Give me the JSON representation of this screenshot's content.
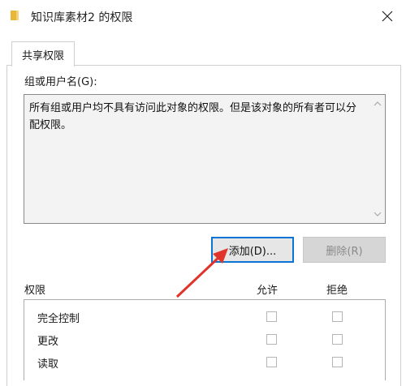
{
  "window": {
    "title": "知识库素材2 的权限",
    "folder_icon": "folder-icon",
    "close_icon": "close-icon",
    "accent_color": "#0a74d4",
    "arrow_color": "#e0342b"
  },
  "tabs": [
    {
      "label": "共享权限",
      "selected": true
    }
  ],
  "users": {
    "label": "组或用户名(G):",
    "message": "所有组或用户均不具有访问此对象的权限。但是该对象的所有者可以分配权限。"
  },
  "buttons": {
    "add": "添加(D)...",
    "remove": "删除(R)"
  },
  "permissions": {
    "label": "权限",
    "allow_header": "允许",
    "deny_header": "拒绝",
    "rows": [
      {
        "name": "完全控制",
        "allow": false,
        "deny": false
      },
      {
        "name": "更改",
        "allow": false,
        "deny": false
      },
      {
        "name": "读取",
        "allow": false,
        "deny": false
      }
    ]
  }
}
